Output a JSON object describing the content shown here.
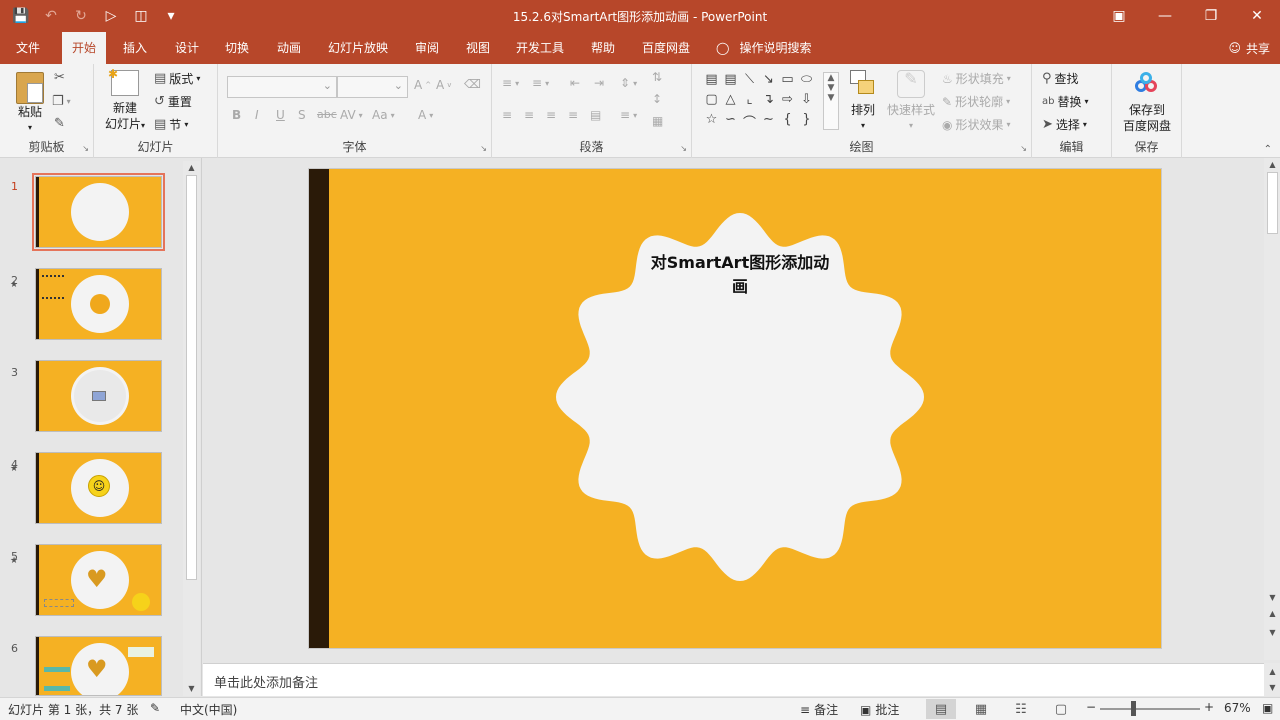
{
  "window": {
    "title": "15.2.6对SmartArt图形添加动画 - PowerPoint"
  },
  "tabs": [
    {
      "label": "文件"
    },
    {
      "label": "开始"
    },
    {
      "label": "插入"
    },
    {
      "label": "设计"
    },
    {
      "label": "切换"
    },
    {
      "label": "动画"
    },
    {
      "label": "幻灯片放映"
    },
    {
      "label": "审阅"
    },
    {
      "label": "视图"
    },
    {
      "label": "开发工具"
    },
    {
      "label": "帮助"
    },
    {
      "label": "百度网盘"
    }
  ],
  "tell_me": "操作说明搜索",
  "share": "共享",
  "ribbon": {
    "clipboard": {
      "label": "剪贴板",
      "paste": "粘贴"
    },
    "slides": {
      "label": "幻灯片",
      "new_slide_1": "新建",
      "new_slide_2": "幻灯片",
      "layout": "版式",
      "reset": "重置",
      "section": "节"
    },
    "font": {
      "label": "字体"
    },
    "paragraph": {
      "label": "段落"
    },
    "drawing": {
      "label": "绘图",
      "arrange": "排列",
      "quick_styles": "快速样式",
      "shape_fill": "形状填充",
      "shape_outline": "形状轮廓",
      "shape_effects": "形状效果"
    },
    "editing": {
      "label": "编辑",
      "find": "查找",
      "replace": "替换",
      "select": "选择"
    },
    "save": {
      "label": "保存",
      "save_to_1": "保存到",
      "save_to_2": "百度网盘"
    }
  },
  "thumbnails": [
    {
      "num": "1"
    },
    {
      "num": "2"
    },
    {
      "num": "3"
    },
    {
      "num": "4"
    },
    {
      "num": "5"
    },
    {
      "num": "6"
    }
  ],
  "slide": {
    "title": "对SmartArt图形添加动画"
  },
  "notes_placeholder": "单击此处添加备注",
  "status": {
    "slide_info": "幻灯片 第 1 张，共 7 张",
    "language": "中文(中国)",
    "notes": "备注",
    "comments": "批注",
    "zoom": "67%"
  },
  "colors": {
    "accent": "#b7472a",
    "slide_bg": "#f5b123",
    "slide_bar": "#2a1a08",
    "flower": "#f3f3f3"
  }
}
